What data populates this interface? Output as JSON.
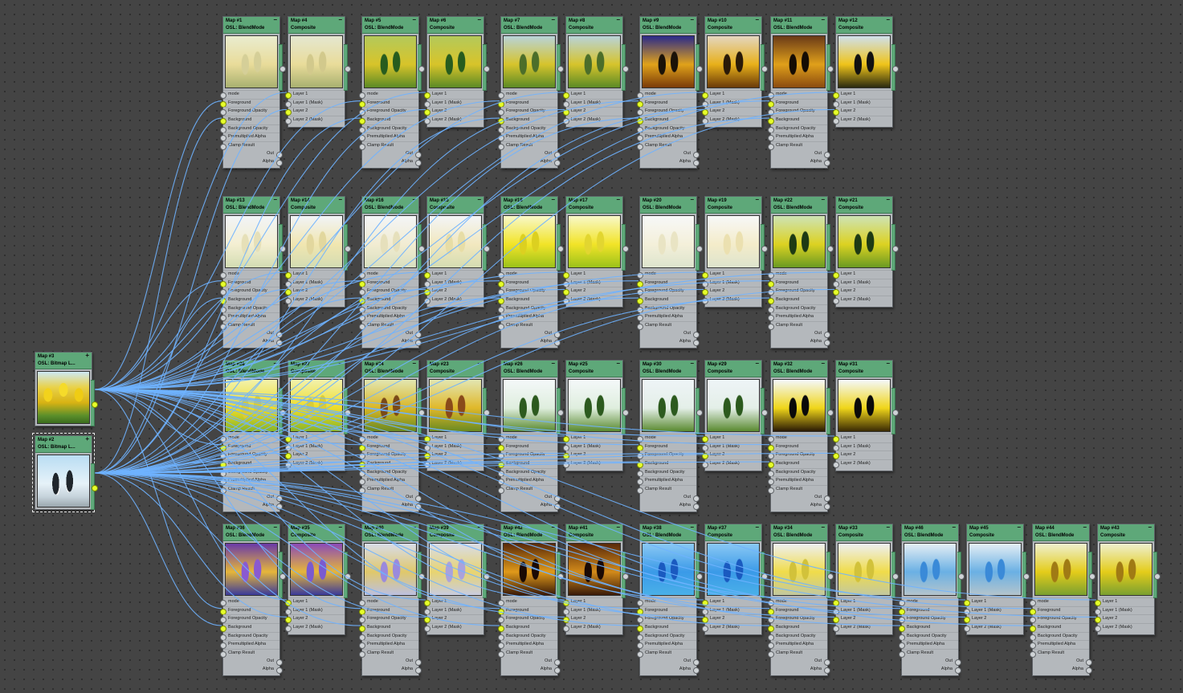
{
  "canvas": {
    "wire_color": "#6fb2ff",
    "node_header_color": "#5ea879"
  },
  "sources": [
    {
      "id": "map3",
      "title": "Map #3",
      "subtitle": "OSL: Bitmap L...",
      "image": "tulip"
    },
    {
      "id": "map2",
      "title": "Map #2",
      "subtitle": "OSL: Bitmap L...",
      "image": "penguin"
    }
  ],
  "blend_ports": [
    "mode",
    "Foreground",
    "Foreground Opacity",
    "Background",
    "Background Opacity",
    "Premultiplied Alpha",
    "Clamp Result"
  ],
  "blend_outputs": [
    "Out",
    "Alpha"
  ],
  "composite_ports": [
    "Layer 1",
    "Layer 1 (Mask)",
    "Layer 2",
    "Layer 2 (Mask)"
  ],
  "nodes": [
    {
      "title": "Map #1",
      "subtitle": "OSL: BlendMode",
      "kind": "blend",
      "colors": [
        "#e9eccf",
        "#e9dc9a",
        "#d5cf98",
        "#a8b070"
      ]
    },
    {
      "title": "Map #4",
      "subtitle": "Composite",
      "kind": "composite",
      "colors": [
        "#e4e7d0",
        "#e9dc9a",
        "#d2c98c",
        "#a8b070"
      ]
    },
    {
      "title": "Map #5",
      "subtitle": "OSL: BlendMode",
      "kind": "blend",
      "colors": [
        "#b3c95b",
        "#d8c42a",
        "#275c1e",
        "#5b8a25"
      ]
    },
    {
      "title": "Map #6",
      "subtitle": "Composite",
      "kind": "composite",
      "colors": [
        "#b3c95b",
        "#d8c42a",
        "#275c1e",
        "#5b8a25"
      ]
    },
    {
      "title": "Map #7",
      "subtitle": "OSL: BlendMode",
      "kind": "blend",
      "colors": [
        "#b8d3d9",
        "#d6c42c",
        "#4c6e2a",
        "#5b8a25"
      ]
    },
    {
      "title": "Map #8",
      "subtitle": "Composite",
      "kind": "composite",
      "colors": [
        "#b8d3d9",
        "#d6c42c",
        "#4c6e2a",
        "#5b8a25"
      ]
    },
    {
      "title": "Map #9",
      "subtitle": "OSL: BlendMode",
      "kind": "blend",
      "colors": [
        "#2a2a8a",
        "#e0a21a",
        "#1a1208",
        "#7a3a08"
      ]
    },
    {
      "title": "Map #10",
      "subtitle": "Composite",
      "kind": "composite",
      "colors": [
        "#e3d6c0",
        "#e8b01a",
        "#2a1a08",
        "#6a3a08"
      ]
    },
    {
      "title": "Map #11",
      "subtitle": "OSL: BlendMode",
      "kind": "blend",
      "colors": [
        "#6a3a18",
        "#e0a01a",
        "#150c04",
        "#8a4a10"
      ]
    },
    {
      "title": "Map #12",
      "subtitle": "Composite",
      "kind": "composite",
      "colors": [
        "#cfe0ec",
        "#efc41a",
        "#111111",
        "#2a2a10"
      ]
    },
    {
      "title": "Map #13",
      "subtitle": "OSL: BlendMode",
      "kind": "blend",
      "colors": [
        "#f1f4f7",
        "#f4efd2",
        "#e6e0b8",
        "#d3dcb2"
      ]
    },
    {
      "title": "Map #14",
      "subtitle": "Composite",
      "kind": "composite",
      "colors": [
        "#f1f4f7",
        "#f1e6b0",
        "#e2d79e",
        "#d3dcb2"
      ]
    },
    {
      "title": "Map #16",
      "subtitle": "OSL: BlendMode",
      "kind": "blend",
      "colors": [
        "#f3f5f7",
        "#f2ecd2",
        "#e6e0bc",
        "#d8dfbf"
      ]
    },
    {
      "title": "Map #15",
      "subtitle": "Composite",
      "kind": "composite",
      "colors": [
        "#f3f5f7",
        "#f2e8bf",
        "#e7dda6",
        "#d5dcb2"
      ]
    },
    {
      "title": "Map #18",
      "subtitle": "OSL: BlendMode",
      "kind": "blend",
      "colors": [
        "#f8f8c9",
        "#f2e428",
        "#dcd020",
        "#9bc21a"
      ]
    },
    {
      "title": "Map #17",
      "subtitle": "Composite",
      "kind": "composite",
      "colors": [
        "#f8f8c9",
        "#f2e428",
        "#e2d630",
        "#9bc21a"
      ]
    },
    {
      "title": "Map #20",
      "subtitle": "OSL: BlendMode",
      "kind": "blend",
      "colors": [
        "#f7f8f8",
        "#f4f0da",
        "#e9e4c4",
        "#dde4cd"
      ]
    },
    {
      "title": "Map #19",
      "subtitle": "Composite",
      "kind": "composite",
      "colors": [
        "#f7f8f8",
        "#f4ecca",
        "#ebe0b0",
        "#dde4cd"
      ]
    },
    {
      "title": "Map #22",
      "subtitle": "OSL: BlendMode",
      "kind": "blend",
      "colors": [
        "#cde3b5",
        "#dcd222",
        "#1e3a14",
        "#6a9a22"
      ]
    },
    {
      "title": "Map #21",
      "subtitle": "Composite",
      "kind": "composite",
      "colors": [
        "#cde3b5",
        "#dcd222",
        "#1e3a14",
        "#6a9a22"
      ]
    },
    {
      "title": "Map #28",
      "subtitle": "OSL: BlendMode",
      "kind": "blend",
      "colors": [
        "#f2f2ad",
        "#eedc28",
        "#d9cc36",
        "#8ab528"
      ]
    },
    {
      "title": "Map #27",
      "subtitle": "Composite",
      "kind": "composite",
      "colors": [
        "#f2f2ad",
        "#eedc28",
        "#d9cc36",
        "#8ab528"
      ]
    },
    {
      "title": "Map #24",
      "subtitle": "OSL: BlendMode",
      "kind": "blend",
      "colors": [
        "#e2e6b2",
        "#d9b625",
        "#7a4a18",
        "#6a8a22"
      ]
    },
    {
      "title": "Map #23",
      "subtitle": "Composite",
      "kind": "composite",
      "colors": [
        "#e2e6b2",
        "#e0b82a",
        "#8a4a1a",
        "#6a8a22"
      ]
    },
    {
      "title": "Map #26",
      "subtitle": "OSL: BlendMode",
      "kind": "blend",
      "colors": [
        "#f4f8f9",
        "#dfeede",
        "#2c5a1e",
        "#5a8a30"
      ]
    },
    {
      "title": "Map #25",
      "subtitle": "Composite",
      "kind": "composite",
      "colors": [
        "#f4f8f9",
        "#dfeede",
        "#2c5a1e",
        "#5a8a30"
      ]
    },
    {
      "title": "Map #30",
      "subtitle": "OSL: BlendMode",
      "kind": "blend",
      "colors": [
        "#eef4f7",
        "#e4efe8",
        "#2c5a1e",
        "#5a8a30"
      ]
    },
    {
      "title": "Map #29",
      "subtitle": "Composite",
      "kind": "composite",
      "colors": [
        "#eef4f7",
        "#e4efe8",
        "#2c5a1e",
        "#5a8a30"
      ]
    },
    {
      "title": "Map #32",
      "subtitle": "OSL: BlendMode",
      "kind": "blend",
      "colors": [
        "#f4f8fb",
        "#f0d61a",
        "#0a0a0a",
        "#2a1a04"
      ]
    },
    {
      "title": "Map #31",
      "subtitle": "Composite",
      "kind": "composite",
      "colors": [
        "#f4f8fb",
        "#f0d61a",
        "#0a0a0a",
        "#3a2a04"
      ]
    },
    {
      "title": "Map #36",
      "subtitle": "OSL: BlendMode",
      "kind": "blend",
      "colors": [
        "#6a3aa8",
        "#e6b63a",
        "#8a5ad0",
        "#3a3a9a"
      ]
    },
    {
      "title": "Map #35",
      "subtitle": "Composite",
      "kind": "composite",
      "colors": [
        "#8a4ab8",
        "#e6b63a",
        "#7a5ad0",
        "#3a3a9a"
      ]
    },
    {
      "title": "Map #40",
      "subtitle": "OSL: BlendMode",
      "kind": "blend",
      "colors": [
        "#d8dce8",
        "#e0c86a",
        "#9a8adc",
        "#bcc0e0"
      ]
    },
    {
      "title": "Map #39",
      "subtitle": "Composite",
      "kind": "composite",
      "colors": [
        "#d8dce8",
        "#e8d470",
        "#aaa2dc",
        "#c8cce0"
      ]
    },
    {
      "title": "Map #42",
      "subtitle": "OSL: BlendMode",
      "kind": "blend",
      "colors": [
        "#5a2a0a",
        "#e09a1a",
        "#1a0a04",
        "#3a1a08"
      ]
    },
    {
      "title": "Map #41",
      "subtitle": "Composite",
      "kind": "composite",
      "colors": [
        "#5a2a0a",
        "#d28a1a",
        "#1a0a04",
        "#3a1a08"
      ]
    },
    {
      "title": "Map #38",
      "subtitle": "OSL: BlendMode",
      "kind": "blend",
      "colors": [
        "#8ac8f4",
        "#3a9ae8",
        "#1a5ac0",
        "#4ab0e8"
      ]
    },
    {
      "title": "Map #37",
      "subtitle": "Composite",
      "kind": "composite",
      "colors": [
        "#8ac8f4",
        "#3a9ae8",
        "#1a5ac0",
        "#4ab0e8"
      ]
    },
    {
      "title": "Map #34",
      "subtitle": "OSL: BlendMode",
      "kind": "blend",
      "colors": [
        "#eef0f2",
        "#f0dc4a",
        "#d2c23a",
        "#c2c8a0"
      ]
    },
    {
      "title": "Map #33",
      "subtitle": "Composite",
      "kind": "composite",
      "colors": [
        "#eef0f2",
        "#f0dc4a",
        "#d2c23a",
        "#c2c8a0"
      ]
    },
    {
      "title": "Map #46",
      "subtitle": "OSL: BlendMode",
      "kind": "blend",
      "colors": [
        "#e4eef4",
        "#6ab0e4",
        "#3a8ad8",
        "#b4c4cc"
      ]
    },
    {
      "title": "Map #45",
      "subtitle": "Composite",
      "kind": "composite",
      "colors": [
        "#e4eef4",
        "#6ab0e4",
        "#3a8ad8",
        "#b4c4cc"
      ]
    },
    {
      "title": "Map #44",
      "subtitle": "OSL: BlendMode",
      "kind": "blend",
      "colors": [
        "#eef0d0",
        "#e4cc1a",
        "#a07a14",
        "#7aa030"
      ]
    },
    {
      "title": "Map #43",
      "subtitle": "Composite",
      "kind": "composite",
      "colors": [
        "#eef0d0",
        "#e4cc1a",
        "#a07a14",
        "#7aa030"
      ]
    }
  ]
}
